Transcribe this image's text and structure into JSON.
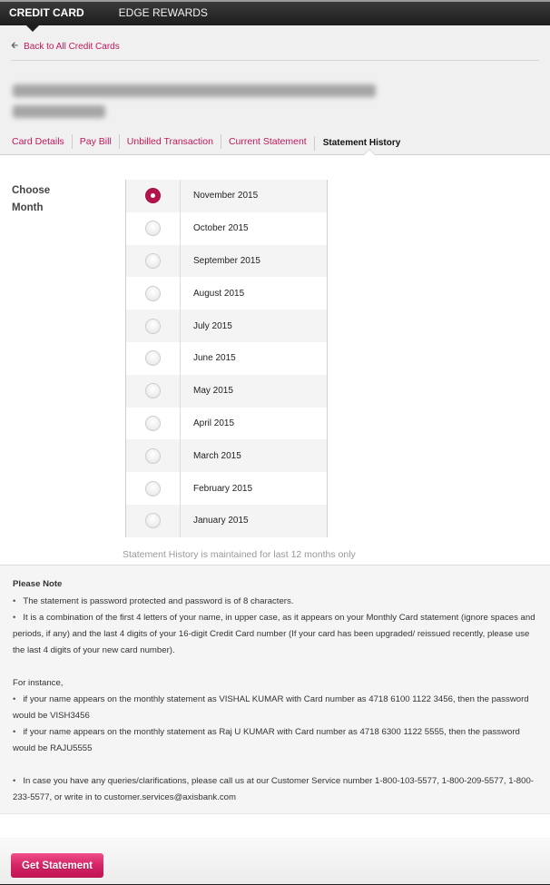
{
  "topnav": {
    "tabs": [
      {
        "label": "CREDIT CARD",
        "active": true
      },
      {
        "label": "EDGE REWARDS",
        "active": false
      }
    ]
  },
  "back_link": {
    "icon": "left-arrow-icon",
    "label": "Back to All Credit Cards"
  },
  "card_title": {
    "text": "[blurred cardholder name and masked card number]"
  },
  "subnav": {
    "items": [
      {
        "label": "Card Details",
        "active": false
      },
      {
        "label": "Pay Bill",
        "active": false
      },
      {
        "label": "Unbilled Transaction",
        "active": false
      },
      {
        "label": "Current Statement",
        "active": false
      },
      {
        "label": "Statement History",
        "active": true
      }
    ]
  },
  "month_picker": {
    "label": "Choose Month",
    "selected": "November 2015",
    "options": [
      "November 2015",
      "October 2015",
      "September 2015",
      "August 2015",
      "July 2015",
      "June 2015",
      "May 2015",
      "April 2015",
      "March 2015",
      "February 2015",
      "January 2015"
    ],
    "hint": "Statement History is maintained for last 12 months only"
  },
  "note": {
    "title": "Please Note",
    "bullets": [
      "The statement is password protected and password is of 8 characters.",
      "It is a combination of the first 4 letters of your name, in upper case, as it appears on your Monthly Card statement (ignore spaces and periods, if any) and the last 4 digits of your 16-digit Credit Card number (If your card has been upgraded/ reissued recently, please use the last 4 digits of your new card number)."
    ],
    "example_intro": "For instance,",
    "examples": [
      "if your name appears on the monthly statement as VISHAL KUMAR with Card number as 4718 6100 1122 3456, then the password would be VISH3456",
      "if your name appears on the monthly statement as Raj U KUMAR with Card number as 4718 6300 1122 5555, then the password would be RAJU5555"
    ],
    "contact": "In case you have any queries/clarifications, please call us at our Customer Service number 1-800-103-5577, 1-800-209-5577, 1-800-233-5577, or write in to customer.services@axisbank.com"
  },
  "actions": {
    "get_statement": "Get Statement"
  },
  "colors": {
    "accent": "#c2185b",
    "radio_checked": "#b5134d",
    "button": "#d52465"
  }
}
